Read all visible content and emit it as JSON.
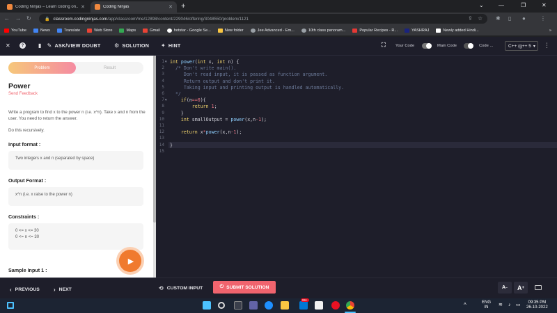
{
  "browser": {
    "tabs": [
      {
        "title": "Coding Ninjas – Learn coding on...",
        "active": false
      },
      {
        "title": "Coding Ninjas",
        "active": true
      }
    ],
    "url_host": "classroom.codingninjas.com",
    "url_path": "/app/classroom/me/12898/content/229046/offering/3048550/problem/1121",
    "bookmarks": [
      {
        "label": "YouTube",
        "color": "#ff0000"
      },
      {
        "label": "News",
        "color": "#4285f4"
      },
      {
        "label": "Translate",
        "color": "#4285f4"
      },
      {
        "label": "Web Store",
        "color": "#ea4335"
      },
      {
        "label": "Maps",
        "color": "#34a853"
      },
      {
        "label": "Gmail",
        "color": "#ea4335"
      },
      {
        "label": "hotstar - Google Se...",
        "color": "#ffffff"
      },
      {
        "label": "New folder",
        "color": "#f9c642"
      },
      {
        "label": "Jee Advanced - Em...",
        "color": "#9aa0a6"
      },
      {
        "label": "10th class panoram...",
        "color": "#9aa0a6"
      },
      {
        "label": "Popular Recipes - R...",
        "color": "#e53935"
      },
      {
        "label": "YASHRAJ",
        "color": "#1a237e"
      },
      {
        "label": "Newly added Hindi...",
        "color": "#ffffff"
      }
    ]
  },
  "toolbar": {
    "ask_doubt": "ASK/VIEW DOUBT",
    "solution": "SOLUTION",
    "hint": "HINT",
    "your_code": "Your Code",
    "main_code": "Main Code",
    "code_more": "Code ...",
    "language": "C++ (g++ 5"
  },
  "problem": {
    "tab_problem": "Problem",
    "tab_result": "Result",
    "title": "Power",
    "feedback": "Send Feedback",
    "desc1": "Write a program to find x to the power n (i.e. x^n). Take x and n from the user. You need to return the answer.",
    "desc2": "Do this recursively.",
    "input_head": "Input format :",
    "input_text": "Two integers x and n (separated by space)",
    "output_head": "Output Format :",
    "output_text": "x^n (i.e. x raise to the power n)",
    "constraints_head": "Constraints :",
    "constraint1": "0 <= x <= 30",
    "constraint2": "0 <= n <= 30",
    "sample_head": "Sample Input 1 :"
  },
  "editor": {
    "line_numbers": [
      "1",
      "2",
      "3",
      "4",
      "5",
      "6",
      "7",
      "8",
      "9",
      "10",
      "11",
      "12",
      "13",
      "14",
      "15"
    ],
    "lines": [
      "int power(int x, int n) {",
      "  /* Don't write main().",
      "     Don't read input, it is passed as function argument.",
      "     Return output and don't print it.",
      "     Taking input and printing output is handled automatically.",
      "  */",
      "    if(n==0){",
      "        return 1;",
      "    }",
      "    int smallOutput = power(x,n-1);",
      "",
      "    return x*power(x,n-1);",
      "",
      "}",
      ""
    ]
  },
  "bottom": {
    "previous": "PREVIOUS",
    "next": "NEXT",
    "custom_input": "CUSTOM INPUT",
    "submit": "SUBMIT SOLUTION",
    "font_minus": "A",
    "font_plus": "A"
  },
  "taskbar": {
    "lang": "ENG",
    "region": "IN",
    "time": "09:35 PM",
    "date": "26-10-2022",
    "badge": "99+"
  },
  "colors": {
    "accent": "#f0646e",
    "fab": "#f07a2e"
  }
}
